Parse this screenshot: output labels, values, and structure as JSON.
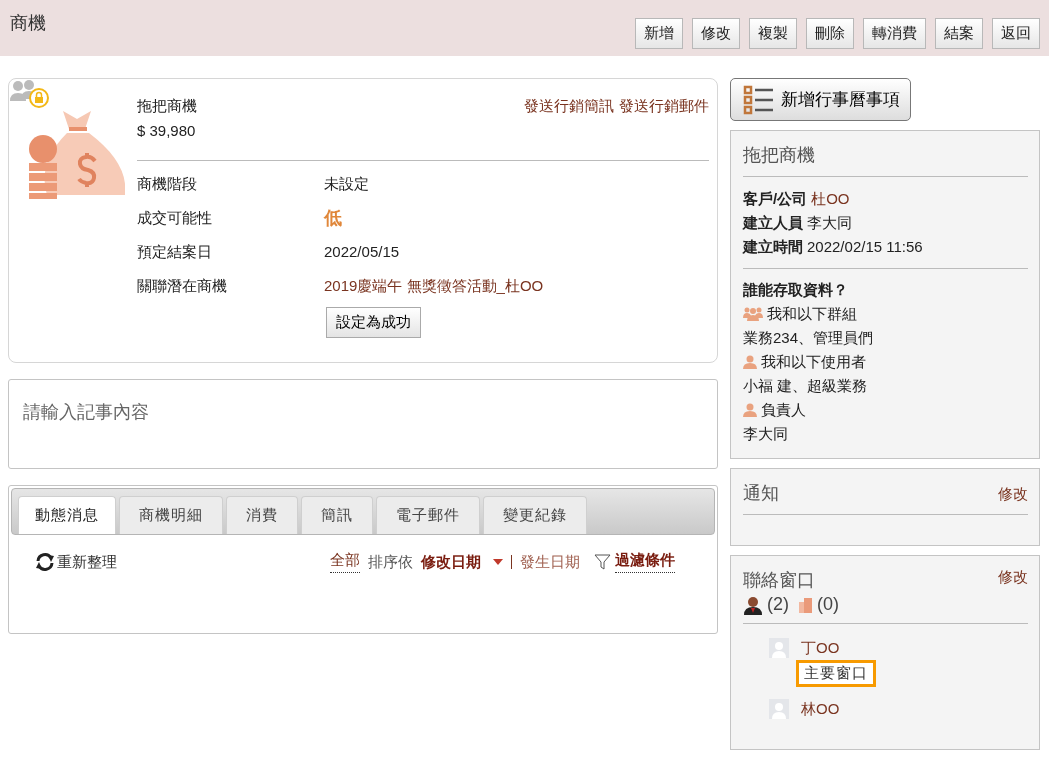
{
  "header": {
    "title": "商機",
    "buttons": [
      "新增",
      "修改",
      "複製",
      "刪除",
      "轉消費",
      "結案",
      "返回"
    ]
  },
  "opportunity": {
    "name": "拖把商機",
    "amount": "$ 39,980",
    "actions": [
      "發送行銷簡訊",
      "發送行銷郵件"
    ],
    "fields": [
      {
        "label": "商機階段",
        "value": "未設定",
        "kind": "text"
      },
      {
        "label": "成交可能性",
        "value": "低",
        "kind": "rating"
      },
      {
        "label": "預定結案日",
        "value": "2022/05/15",
        "kind": "text"
      },
      {
        "label": "關聯潛在商機",
        "value": "2019慶端午 無獎徵答活動_杜OO",
        "kind": "link"
      }
    ],
    "success_button": "設定為成功"
  },
  "note": {
    "placeholder": "請輸入記事內容"
  },
  "activity": {
    "tabs": [
      {
        "label": "動態消息",
        "selected": true
      },
      {
        "label": "商機明細",
        "selected": false
      },
      {
        "label": "消費",
        "selected": false
      },
      {
        "label": "簡訊",
        "selected": false
      },
      {
        "label": "電子郵件",
        "selected": false
      },
      {
        "label": "變更紀錄",
        "selected": false
      }
    ],
    "refresh": "重新整理",
    "filter_all": "全部",
    "sort_label": "排序依",
    "sort_options": [
      {
        "label": "修改日期",
        "selected": true
      },
      {
        "label": "發生日期",
        "selected": false
      }
    ],
    "filter_conditions": "過濾條件"
  },
  "sidebar": {
    "calendar_button": "新增行事曆事項",
    "summary": {
      "title": "拖把商機",
      "rows": [
        {
          "label": "客戶/公司",
          "value": "杜OO",
          "kind": "link"
        },
        {
          "label": "建立人員",
          "value": "李大同",
          "kind": "text"
        },
        {
          "label": "建立時間",
          "value": "2022/02/15 11:56",
          "kind": "text"
        }
      ],
      "access_title": "誰能存取資料？",
      "access": [
        {
          "kind": "group",
          "label": "我和以下群組",
          "members": "業務234、管理員們"
        },
        {
          "kind": "user",
          "label": "我和以下使用者",
          "members": "小福 建、超級業務"
        },
        {
          "kind": "owner",
          "label": "負責人",
          "members": "李大同"
        }
      ]
    },
    "notification": {
      "title": "通知",
      "edit": "修改"
    },
    "contacts": {
      "title": "聯絡窗口",
      "edit": "修改",
      "person_count": "(2)",
      "company_count": "(0)",
      "people": [
        {
          "name": "丁OO",
          "tag": "主要窗口"
        },
        {
          "name": "林OO"
        }
      ]
    }
  }
}
